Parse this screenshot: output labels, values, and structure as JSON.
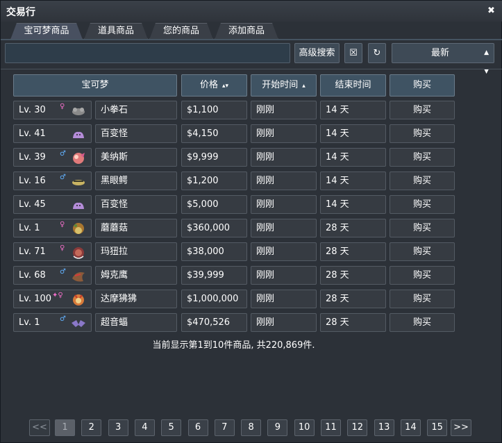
{
  "window": {
    "title": "交易行",
    "close_symbol": "✖"
  },
  "tabs": [
    {
      "label": "宝可梦商品",
      "active": true
    },
    {
      "label": "道具商品",
      "active": false
    },
    {
      "label": "您的商品",
      "active": false
    },
    {
      "label": "添加商品",
      "active": false
    }
  ],
  "search": {
    "value": "",
    "placeholder": "",
    "advanced_label": "高级搜索",
    "clear_icon": "☒",
    "refresh_icon": "↻",
    "sort_value": "最新"
  },
  "headers": {
    "pokemon": "宝可梦",
    "price": "价格",
    "start_time": "开始时间",
    "end_time": "结束时间",
    "buy": "购买"
  },
  "listings": [
    {
      "level": "Lv. 30",
      "gender": "♀",
      "gender_color": "#f06ec8",
      "sprite": "geodude-sprite",
      "name": "小拳石",
      "price": "$1,100",
      "start": "刚刚",
      "end": "14 天",
      "buy": "购买"
    },
    {
      "level": "Lv. 41",
      "gender": "",
      "gender_color": "",
      "sprite": "ditto-sprite",
      "name": "百变怪",
      "price": "$4,150",
      "start": "刚刚",
      "end": "14 天",
      "buy": "购买"
    },
    {
      "level": "Lv. 39",
      "gender": "♂",
      "gender_color": "#62b2ff",
      "sprite": "manaphy-sprite",
      "name": "美纳斯",
      "price": "$9,999",
      "start": "刚刚",
      "end": "14 天",
      "buy": "购买"
    },
    {
      "level": "Lv. 16",
      "gender": "♂",
      "gender_color": "#62b2ff",
      "sprite": "sandile-sprite",
      "name": "黑眼鳄",
      "price": "$1,200",
      "start": "刚刚",
      "end": "14 天",
      "buy": "购买"
    },
    {
      "level": "Lv. 45",
      "gender": "",
      "gender_color": "",
      "sprite": "ditto-sprite",
      "name": "百变怪",
      "price": "$5,000",
      "start": "刚刚",
      "end": "14 天",
      "buy": "购买"
    },
    {
      "level": "Lv. 1",
      "gender": "♀",
      "gender_color": "#f06ec8",
      "sprite": "shroomish-sprite",
      "name": "蘑蘑菇",
      "price": "$360,000",
      "start": "刚刚",
      "end": "28 天",
      "buy": "购买"
    },
    {
      "level": "Lv. 71",
      "gender": "♀",
      "gender_color": "#f06ec8",
      "sprite": "mamoswine-sprite",
      "name": "玛狃拉",
      "price": "$38,000",
      "start": "刚刚",
      "end": "28 天",
      "buy": "购买"
    },
    {
      "level": "Lv. 68",
      "gender": "♂",
      "gender_color": "#62b2ff",
      "sprite": "staraptor-sprite",
      "name": "姆克鹰",
      "price": "$39,999",
      "start": "刚刚",
      "end": "28 天",
      "buy": "购买"
    },
    {
      "level": "Lv. 100",
      "gender": "✦♀",
      "gender_color": "#f06ec8",
      "sprite": "darmanitan-sprite",
      "name": "达摩狒狒",
      "price": "$1,000,000",
      "start": "刚刚",
      "end": "28 天",
      "buy": "购买"
    },
    {
      "level": "Lv. 1",
      "gender": "♂",
      "gender_color": "#62b2ff",
      "sprite": "zubat-sprite",
      "name": "超音蝠",
      "price": "$470,526",
      "start": "刚刚",
      "end": "28 天",
      "buy": "购买"
    }
  ],
  "summary": "当前显示第1到10件商品, 共220,869件.",
  "pagination": {
    "prev": "<<",
    "pages": [
      "1",
      "2",
      "3",
      "4",
      "5",
      "6",
      "7",
      "8",
      "9",
      "10",
      "11",
      "12",
      "13",
      "14",
      "15"
    ],
    "current": "1",
    "next": ">>"
  }
}
